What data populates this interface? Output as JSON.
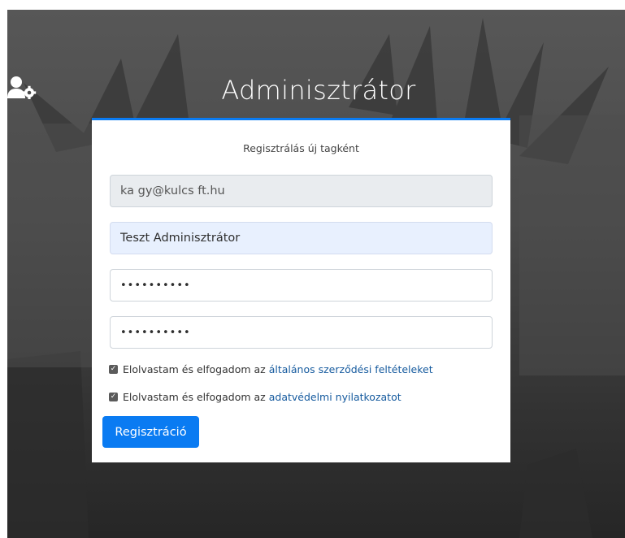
{
  "header": {
    "title": "Adminisztrátor",
    "icon": "user-gear-icon"
  },
  "form": {
    "subtitle": "Regisztrálás új tagként",
    "email_value": "ka gy@kulcs ft.hu",
    "name_value": "Teszt Adminisztrátor",
    "password_value": "••••••••••",
    "password_confirm_value": "••••••••••",
    "terms": {
      "text": "Elolvastam és elfogadom az",
      "link": "általános szerződési feltételeket",
      "checked": true
    },
    "privacy": {
      "text": "Elolvastam és elfogadom az",
      "link": "adatvédelmi nyilatkozatot",
      "checked": true
    },
    "submit_label": "Regisztráció"
  },
  "colors": {
    "accent": "#0a7bf2",
    "link": "#155a9e",
    "autofill_bg": "#e8f0fe",
    "readonly_bg": "#e9ecef"
  }
}
